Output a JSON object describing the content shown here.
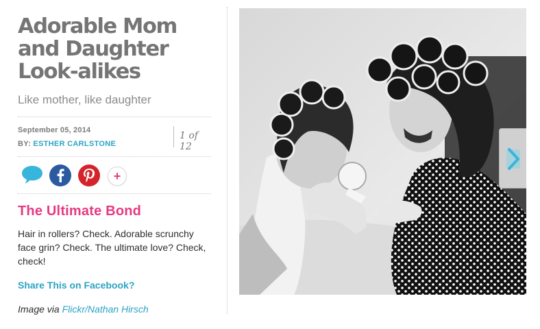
{
  "article": {
    "title": "Adorable Mom and Daughter Look-alikes",
    "subtitle": "Like mother, like daughter",
    "date": "September 05, 2014",
    "by_label": "BY:",
    "author": "ESTHER CARLSTONE",
    "counter": "1 of 12"
  },
  "social": {
    "icons": [
      "comment-bubble-icon",
      "facebook-icon",
      "pinterest-icon",
      "plus-icon"
    ],
    "more_label": "+",
    "colors": {
      "comment": "#38b5dd",
      "facebook": "#2c5aa0",
      "pinterest": "#d3242b",
      "plus": "#e63983"
    }
  },
  "slide": {
    "section_title": "The Ultimate Bond",
    "text": "Hair in rollers? Check. Adorable scrunchy face grin? Check. The ultimate love? Check, check!",
    "share_label": "Share This on Facebook?",
    "credit_prefix": "Image via",
    "credit_link": "Flickr/Nathan Hirsch"
  },
  "colors": {
    "accent_pink": "#e63983",
    "accent_blue": "#2ba3c4",
    "title_gray": "#757575"
  },
  "photo": {
    "alt_icon": "photo-mother-daughter-rollers",
    "next_icon": "chevron-right-icon"
  }
}
